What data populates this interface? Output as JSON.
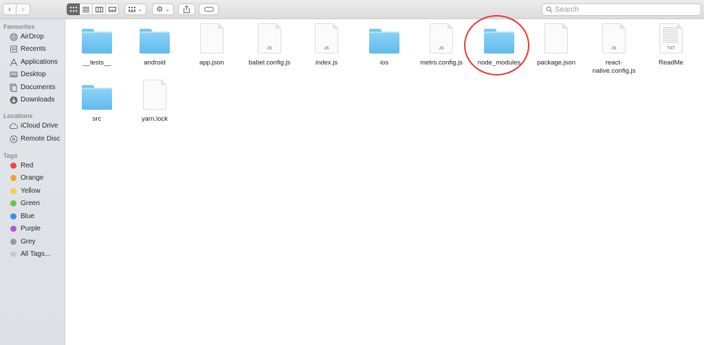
{
  "toolbar": {
    "search_placeholder": "Search"
  },
  "sidebar": {
    "favourites_title": "Favourites",
    "favourites": [
      {
        "label": "AirDrop",
        "icon": "airdrop-icon"
      },
      {
        "label": "Recents",
        "icon": "recents-icon"
      },
      {
        "label": "Applications",
        "icon": "applications-icon"
      },
      {
        "label": "Desktop",
        "icon": "desktop-icon"
      },
      {
        "label": "Documents",
        "icon": "documents-icon"
      },
      {
        "label": "Downloads",
        "icon": "downloads-icon"
      }
    ],
    "locations_title": "Locations",
    "locations": [
      {
        "label": "iCloud Drive",
        "icon": "cloud-icon"
      },
      {
        "label": "Remote Disc",
        "icon": "disc-icon"
      }
    ],
    "tags_title": "Tags",
    "tags": [
      {
        "label": "Red",
        "color": "#f0473f"
      },
      {
        "label": "Orange",
        "color": "#f6a033"
      },
      {
        "label": "Yellow",
        "color": "#f7d04a"
      },
      {
        "label": "Green",
        "color": "#5dc853"
      },
      {
        "label": "Blue",
        "color": "#3c8cf2"
      },
      {
        "label": "Purple",
        "color": "#b05ad2"
      },
      {
        "label": "Grey",
        "color": "#9a9a9a"
      },
      {
        "label": "All Tags...",
        "color": "#c8cbce"
      }
    ]
  },
  "files": [
    {
      "label": "__tests__",
      "type": "folder"
    },
    {
      "label": "android",
      "type": "folder"
    },
    {
      "label": "app.json",
      "type": "document",
      "ext": ""
    },
    {
      "label": "babel.config.js",
      "type": "document",
      "ext": "JS"
    },
    {
      "label": "index.js",
      "type": "document",
      "ext": "JS"
    },
    {
      "label": "ios",
      "type": "folder"
    },
    {
      "label": "metro.config.js",
      "type": "document",
      "ext": "JS"
    },
    {
      "label": "node_modules",
      "type": "folder"
    },
    {
      "label": "package.json",
      "type": "document",
      "ext": ""
    },
    {
      "label": "react-native.config.js",
      "type": "document",
      "ext": "JS",
      "label_lines": [
        "react-",
        "native.config.js"
      ]
    },
    {
      "label": "ReadMe",
      "type": "text-document",
      "ext": "TXT"
    },
    {
      "label": "src",
      "type": "folder"
    },
    {
      "label": "yarn.lock",
      "type": "document",
      "ext": ""
    }
  ],
  "highlight": {
    "target": "node_modules",
    "color": "#e8342f"
  }
}
